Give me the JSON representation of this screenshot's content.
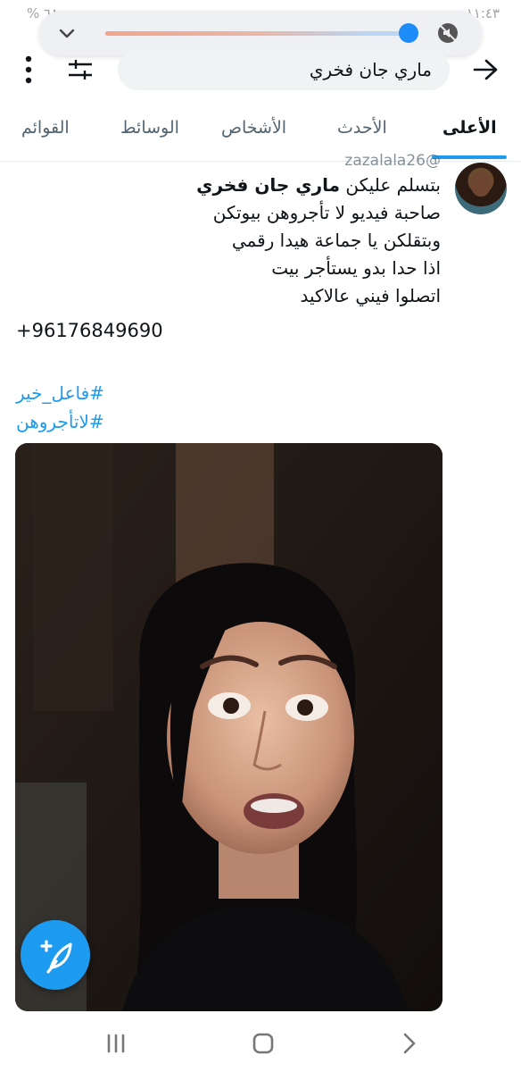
{
  "status": {
    "left_text": "% ٦٨",
    "right_text": "١١:٤٣"
  },
  "volume": {
    "level_fraction": 0.86,
    "accent": "#1d8cf8"
  },
  "search": {
    "query": "ماري جان فخري"
  },
  "tabs": [
    {
      "label": "الأعلى",
      "active": true
    },
    {
      "label": "الأحدث"
    },
    {
      "label": "الأشخاص"
    },
    {
      "label": "الوسائط"
    },
    {
      "label": "القوائم"
    }
  ],
  "tweet": {
    "handle_partial": "@zazalala26",
    "lines": {
      "l1_prefix": "بتسلم عليكن ",
      "l1_highlight": "ماري جان فخري",
      "l2": "صاحبة فيديو لا تأجروهن بيوتكن",
      "l3": "وبتقلكن يا جماعة هيدا رقمي",
      "l4": "اذا حدا بدو يستأجر بيت",
      "l5": "اتصلوا فيني عالاكيد"
    },
    "phone": "+96176849690",
    "hashtags": [
      "#فاعل_خير",
      "#لاتأجروهن"
    ]
  },
  "colors": {
    "accent": "#1d9bf0",
    "text": "#0f1419",
    "muted": "#536471"
  },
  "icons": {
    "fab": "compose-tweet-icon",
    "back": "arrow-back-icon",
    "filter": "sliders-icon",
    "menu": "kebab-menu-icon"
  }
}
